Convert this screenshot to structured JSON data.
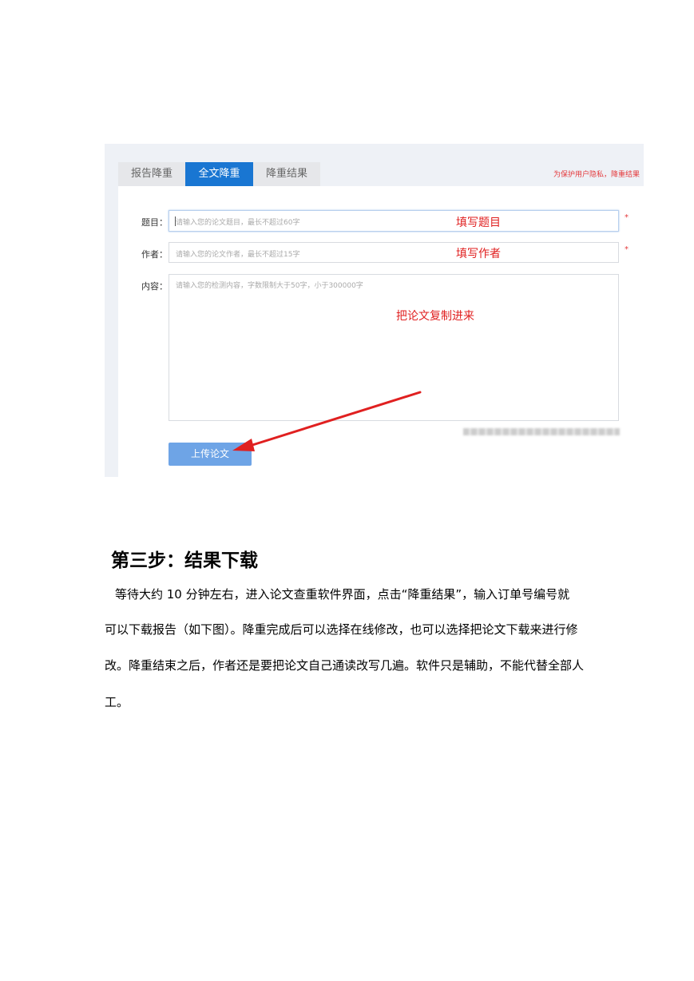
{
  "screenshot": {
    "tabs": [
      {
        "label": "报告降重",
        "active": false
      },
      {
        "label": "全文降重",
        "active": true
      },
      {
        "label": "降重结果",
        "active": false
      }
    ],
    "privacy_note": "为保护用户隐私，降重结果",
    "form": {
      "title_label": "题目：",
      "title_placeholder": "请输入您的论文题目，最长不超过60字",
      "author_label": "作者：",
      "author_placeholder": "请输入您的论文作者，最长不超过15字",
      "content_label": "内容：",
      "content_placeholder": "请输入您的检测内容，字数限制大于50字，小于300000字",
      "required_mark": "*",
      "upload_label": "上传论文"
    },
    "annotations": {
      "title": "填写题目",
      "author": "填写作者",
      "content": "把论文复制进来"
    },
    "colors": {
      "accent": "#1976d2",
      "annotation": "#e02020",
      "upload": "#6ea4e6"
    }
  },
  "document": {
    "heading": "第三步：结果下载",
    "paragraph_lines": [
      "等待大约 10 分钟左右，进入论文查重软件界面，点击“降重结果”，输入订单号编号就",
      "可以下载报告（如下图）。降重完成后可以选择在线修改，也可以选择把论文下载来进行修",
      "改。降重结束之后，作者还是要把论文自己通读改写几遍。软件只是辅助，不能代替全部人",
      "工。"
    ]
  }
}
